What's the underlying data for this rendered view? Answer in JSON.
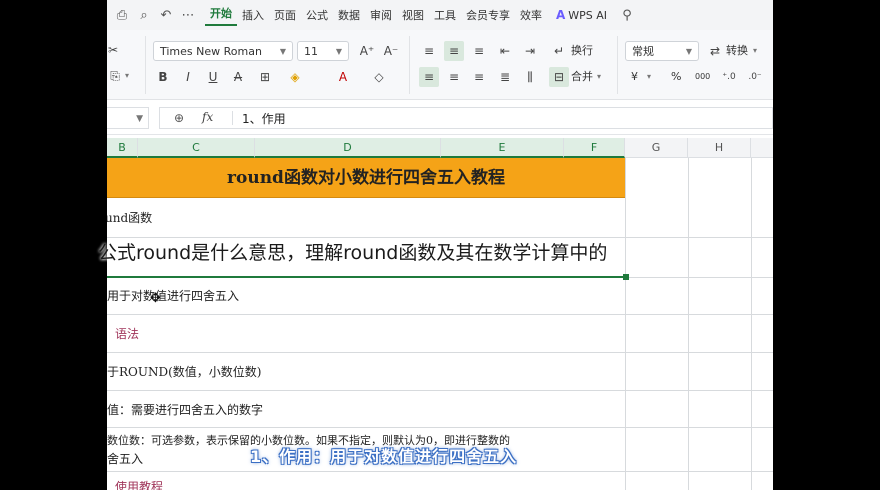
{
  "menubar": {
    "quick_icons": [
      "print-icon",
      "print-preview-icon",
      "undo-icon",
      "more-icon"
    ],
    "items": [
      "开始",
      "插入",
      "页面",
      "公式",
      "数据",
      "审阅",
      "视图",
      "工具",
      "会员专享",
      "效率"
    ],
    "active_item": "开始",
    "wps_ai_label": "WPS AI",
    "search_icon": "search-icon"
  },
  "ribbon": {
    "font_name": "Times New Roman",
    "font_size": "11",
    "wrap_label": "换行",
    "merge_label": "合并",
    "number_format": "常规",
    "convert_label": "转换",
    "currency_symbol": "¥",
    "percent_symbol": "%",
    "thousands_symbol": "000"
  },
  "formula_bar": {
    "fx_label": "fx",
    "content": "1、作用"
  },
  "columns": [
    "B",
    "C",
    "D",
    "E",
    "F",
    "G",
    "H"
  ],
  "sheet": {
    "title": "round函数对小数进行四舍五入教程",
    "rows": [
      {
        "text": "und函数",
        "style": "normal"
      },
      {
        "text": "",
        "style": "normal"
      },
      {
        "text": "用于对数值进行四舍五入",
        "style": "normal"
      },
      {
        "text": "语法",
        "style": "heading"
      },
      {
        "text": "于ROUND(数值，小数位数)",
        "style": "normal"
      },
      {
        "text": "值：需要进行四舍五入的数字",
        "style": "normal"
      },
      {
        "text": "数位数：可选参数，表示保留的小数位数。如果不指定，则默认为0，即进行整数的",
        "text2": "舍五入",
        "style": "normal"
      },
      {
        "text": "使用教程",
        "style": "heading"
      }
    ]
  },
  "overlays": {
    "subtitle": "公式round是什么意思，理解round函数及其在数学计算中的",
    "caption": "1、作用：用于对数值进行四舍五入"
  },
  "colors": {
    "title_fill": "#f5a317",
    "accent_green": "#1f7a3c",
    "heading_text": "#a0355a",
    "caption_outline": "#3b6fc4"
  }
}
